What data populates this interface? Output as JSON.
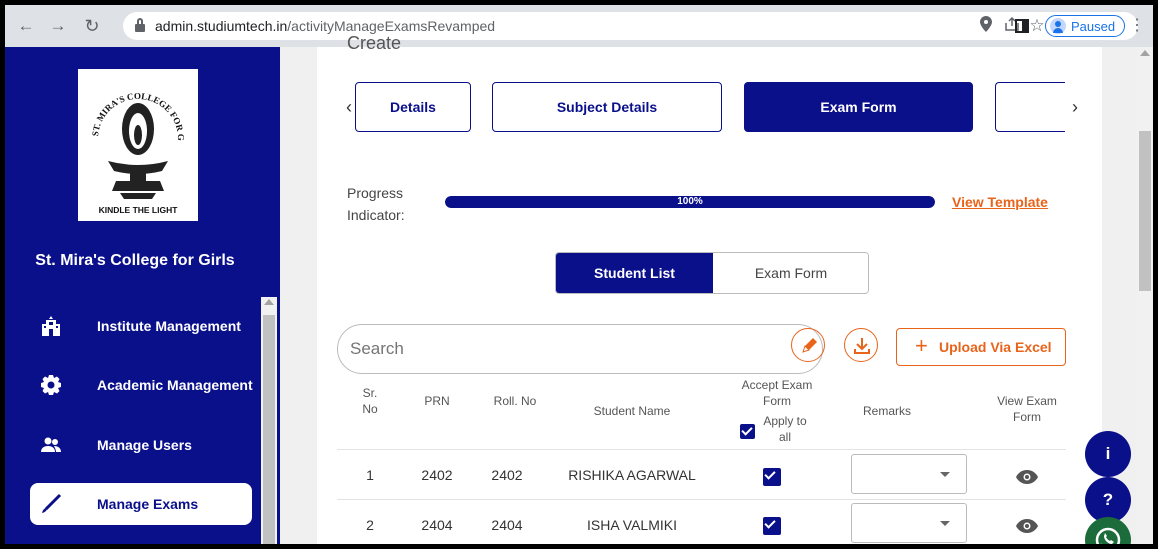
{
  "browser": {
    "url_host": "admin.studiumtech.in",
    "url_path": "/activityManageExamsRevamped",
    "profile_status": "Paused"
  },
  "sidebar": {
    "logo_text": "KINDLE THE LIGHT",
    "logo_arc": "ST. MIRA'S COLLEGE FOR GIRLS",
    "college_name": "St. Mira's College for Girls",
    "items": [
      {
        "label": "Institute Management",
        "icon": "building-icon"
      },
      {
        "label": "Academic Management",
        "icon": "gear-icon"
      },
      {
        "label": "Manage Users",
        "icon": "users-icon"
      },
      {
        "label": "Manage Exams",
        "icon": "pen-icon",
        "active": true
      }
    ]
  },
  "main": {
    "panel_title": "Create",
    "steps": [
      "Details",
      "Subject Details",
      "Exam Form",
      ""
    ],
    "progress": {
      "label": "Progress Indicator:",
      "value": 100,
      "value_text": "100%"
    },
    "view_template": "View Template",
    "toggle": [
      "Student List",
      "Exam Form"
    ],
    "search_placeholder": "Search",
    "upload_label": "Upload Via Excel",
    "table": {
      "headers": {
        "sr": "Sr. No",
        "prn": "PRN",
        "roll": "Roll. No",
        "name": "Student Name",
        "accept": "Accept Exam Form",
        "apply_all": "Apply to all",
        "remarks": "Remarks",
        "view": "View Exam Form"
      },
      "rows": [
        {
          "sr": "1",
          "prn": "2402",
          "roll": "2402",
          "name": "RISHIKA AGARWAL",
          "accepted": true
        },
        {
          "sr": "2",
          "prn": "2404",
          "roll": "2404",
          "name": "ISHA VALMIKI",
          "accepted": true
        }
      ]
    },
    "fabs": [
      {
        "label": "i",
        "icon": "info-icon"
      },
      {
        "label": "?",
        "icon": "help-icon"
      },
      {
        "label": "",
        "icon": "whatsapp-icon"
      }
    ]
  },
  "colors": {
    "brand_navy": "#0a0f8a",
    "accent_orange": "#e8641b",
    "whatsapp_green": "#1c6b3a"
  }
}
